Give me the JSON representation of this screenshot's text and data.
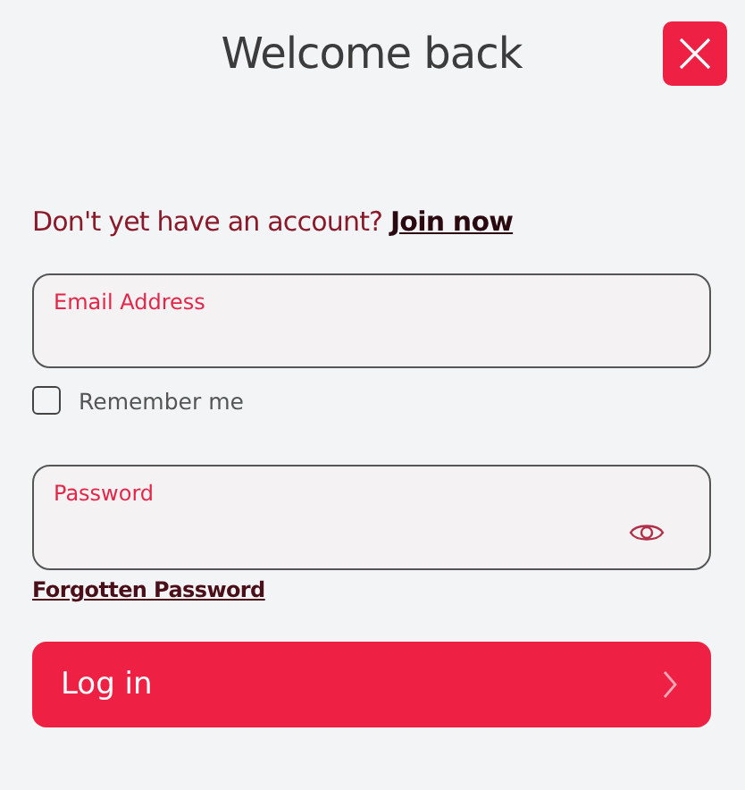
{
  "title": "Welcome back",
  "signup": {
    "prompt": "Don't yet have an account?",
    "link": "Join now"
  },
  "email": {
    "label": "Email Address"
  },
  "remember": {
    "label": "Remember me",
    "checked": false
  },
  "password": {
    "label": "Password"
  },
  "forgot": "Forgotten Password",
  "submit": "Log in"
}
